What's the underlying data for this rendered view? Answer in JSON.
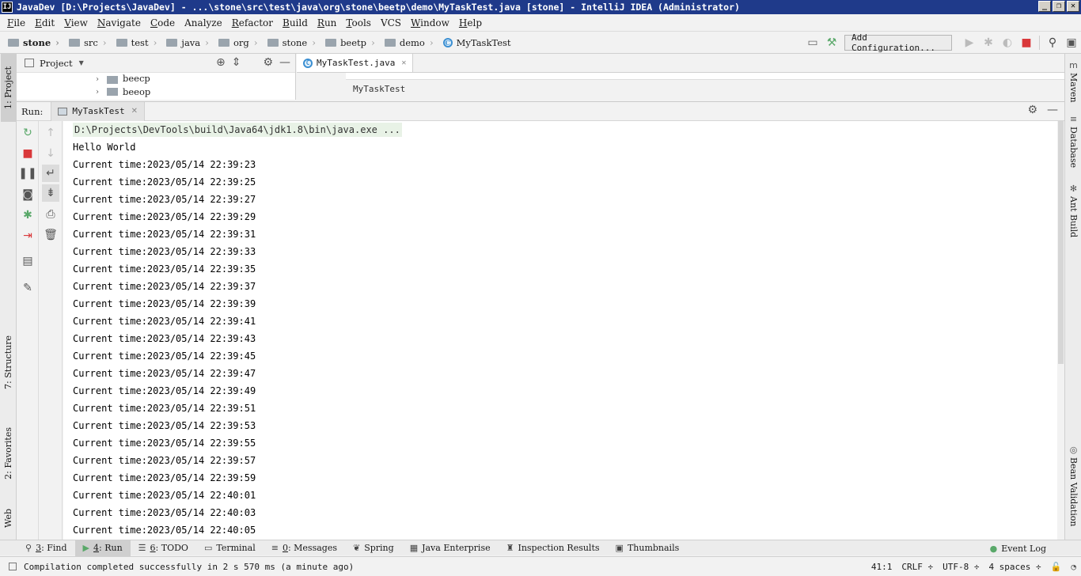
{
  "window": {
    "title": "JavaDev [D:\\Projects\\JavaDev] - ...\\stone\\src\\test\\java\\org\\stone\\beetp\\demo\\MyTaskTest.java [stone] - IntelliJ IDEA (Administrator)",
    "app_icon": "IJ",
    "minimize": "_",
    "restore": "❐",
    "close": "✕"
  },
  "menu": {
    "items": [
      {
        "u": "F",
        "rest": "ile"
      },
      {
        "u": "E",
        "rest": "dit"
      },
      {
        "u": "V",
        "rest": "iew"
      },
      {
        "u": "N",
        "rest": "avigate"
      },
      {
        "u": "C",
        "rest": "ode"
      },
      {
        "u": "",
        "rest": "Analyze"
      },
      {
        "u": "R",
        "rest": "efactor"
      },
      {
        "u": "B",
        "rest": "uild"
      },
      {
        "u": "R",
        "rest": "un"
      },
      {
        "u": "T",
        "rest": "ools"
      },
      {
        "u": "",
        "rest": "VCS"
      },
      {
        "u": "W",
        "rest": "indow"
      },
      {
        "u": "H",
        "rest": "elp"
      }
    ]
  },
  "breadcrumbs": [
    "stone",
    "src",
    "test",
    "java",
    "org",
    "stone",
    "beetp",
    "demo",
    "MyTaskTest"
  ],
  "navbar": {
    "add_configuration": "Add Configuration..."
  },
  "left_stripe": {
    "project": "1: Project",
    "structure": "7: Structure",
    "favorites": "2: Favorites",
    "web": "Web"
  },
  "right_stripe": {
    "maven": "Maven",
    "database": "Database",
    "ant": "Ant Build",
    "bean": "Bean Validation"
  },
  "project_panel": {
    "title": "Project",
    "tree": [
      "beecp",
      "beeop"
    ]
  },
  "editor": {
    "tab": "MyTaskTest.java",
    "crumb": "MyTaskTest"
  },
  "run_panel": {
    "label": "Run:",
    "tab": "MyTaskTest",
    "console": [
      "D:\\Projects\\DevTools\\build\\Java64\\jdk1.8\\bin\\java.exe ...",
      "Hello World",
      "Current time:2023/05/14 22:39:23",
      "Current time:2023/05/14 22:39:25",
      "Current time:2023/05/14 22:39:27",
      "Current time:2023/05/14 22:39:29",
      "Current time:2023/05/14 22:39:31",
      "Current time:2023/05/14 22:39:33",
      "Current time:2023/05/14 22:39:35",
      "Current time:2023/05/14 22:39:37",
      "Current time:2023/05/14 22:39:39",
      "Current time:2023/05/14 22:39:41",
      "Current time:2023/05/14 22:39:43",
      "Current time:2023/05/14 22:39:45",
      "Current time:2023/05/14 22:39:47",
      "Current time:2023/05/14 22:39:49",
      "Current time:2023/05/14 22:39:51",
      "Current time:2023/05/14 22:39:53",
      "Current time:2023/05/14 22:39:55",
      "Current time:2023/05/14 22:39:57",
      "Current time:2023/05/14 22:39:59",
      "Current time:2023/05/14 22:40:01",
      "Current time:2023/05/14 22:40:03",
      "Current time:2023/05/14 22:40:05"
    ]
  },
  "bottom_tabs": [
    {
      "num": "3",
      "label": ": Find",
      "icon": "search-icon"
    },
    {
      "num": "4",
      "label": ": Run",
      "icon": "run-icon",
      "active": true
    },
    {
      "num": "6",
      "label": ": TODO",
      "icon": "todo-icon"
    },
    {
      "num": "",
      "label": "Terminal",
      "icon": "terminal-icon"
    },
    {
      "num": "0",
      "label": ": Messages",
      "icon": "messages-icon"
    },
    {
      "num": "",
      "label": "Spring",
      "icon": "spring-icon"
    },
    {
      "num": "",
      "label": "Java Enterprise",
      "icon": "java-enterprise-icon"
    },
    {
      "num": "",
      "label": "Inspection Results",
      "icon": "inspection-icon"
    },
    {
      "num": "",
      "label": "Thumbnails",
      "icon": "thumbnails-icon"
    }
  ],
  "event_log": "Event Log",
  "status": {
    "message": "Compilation completed successfully in 2 s 570 ms (a minute ago)",
    "position": "41:1",
    "line_sep": "CRLF ÷",
    "encoding": "UTF-8 ÷",
    "indent": "4 spaces ÷"
  },
  "colors": {
    "titlebar": "#1f3a8a",
    "stop_red": "#d9383a",
    "run_green": "#59a869",
    "class_blue": "#3b8fd2"
  }
}
